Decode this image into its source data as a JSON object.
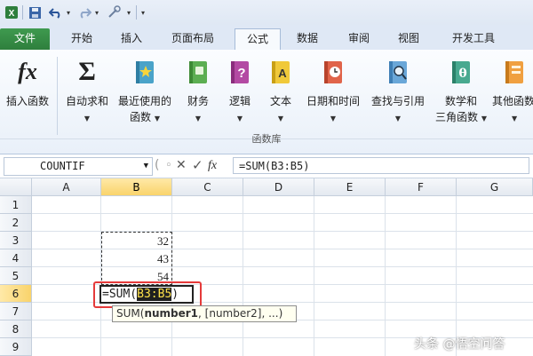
{
  "quick_access": {
    "app_icon": "excel-icon",
    "icons": [
      "save-icon",
      "undo-icon",
      "redo-icon",
      "customize-icon"
    ]
  },
  "tabs": [
    "文件",
    "开始",
    "插入",
    "页面布局",
    "公式",
    "数据",
    "审阅",
    "视图",
    "开发工具"
  ],
  "active_tab": "公式",
  "ribbon": {
    "group_label": "函数库",
    "buttons": [
      {
        "label": "插入函数",
        "icon": "fx-icon"
      },
      {
        "label": "自动求和",
        "icon": "sigma-icon"
      },
      {
        "label": "最近使用的",
        "label2": "函数",
        "icon": "star-book-icon"
      },
      {
        "label": "财务",
        "icon": "finance-book-icon"
      },
      {
        "label": "逻辑",
        "icon": "logic-book-icon"
      },
      {
        "label": "文本",
        "icon": "text-book-icon"
      },
      {
        "label": "日期和时间",
        "icon": "clock-book-icon"
      },
      {
        "label": "查找与引用",
        "icon": "search-book-icon"
      },
      {
        "label": "数学和",
        "label2": "三角函数",
        "icon": "theta-book-icon"
      },
      {
        "label": "其他函数",
        "icon": "more-book-icon"
      }
    ],
    "icon_glyphs": {
      "fx": "fx",
      "sigma": "Σ",
      "logic": "?",
      "text": "A",
      "math": "θ"
    }
  },
  "formula_bar": {
    "name_box": "COUNTIF",
    "formula": "=SUM(B3:B5)",
    "fx_label": "fx"
  },
  "grid": {
    "columns": [
      "A",
      "B",
      "C",
      "D",
      "E",
      "F",
      "G"
    ],
    "selected_column": "B",
    "rows": [
      "1",
      "2",
      "3",
      "4",
      "5",
      "6",
      "7",
      "8",
      "9"
    ],
    "selected_row": "6",
    "cells": {
      "B3": "32",
      "B4": "43",
      "B5": "54"
    },
    "editing_cell": {
      "prefix": "=SUM(",
      "ref": "B3:B5",
      "suffix": ")"
    },
    "tooltip": {
      "fn": "SUM(",
      "arg1": "number1",
      "rest": ", [number2], ...)"
    }
  },
  "watermark": "头条 @悟空问答",
  "colors": {
    "accent_green": "#2e7f3d",
    "highlight_red": "#e53a3a",
    "selection_yellow": "#f9d36b"
  }
}
